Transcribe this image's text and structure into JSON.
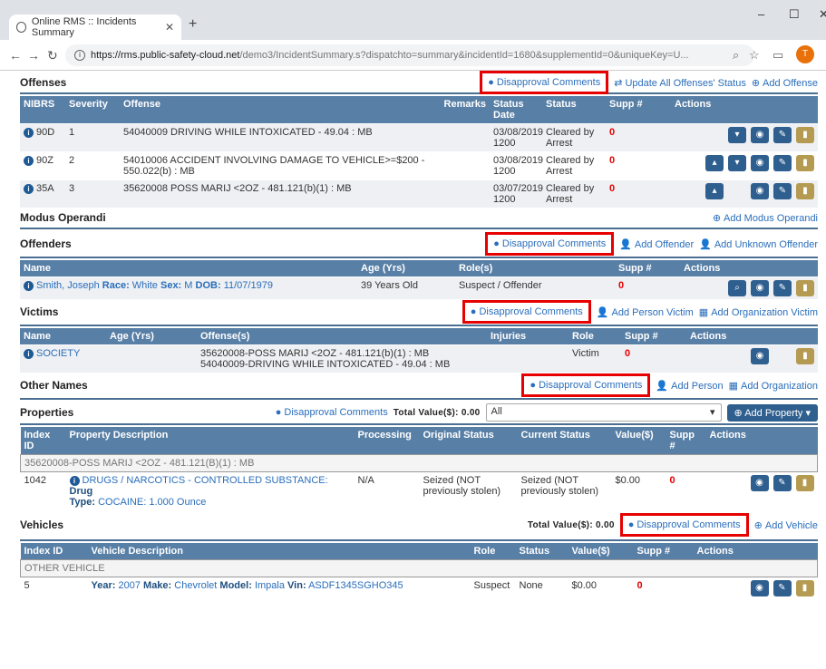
{
  "browser": {
    "tab_title": "Online RMS :: Incidents Summary",
    "url_host": "https://rms.public-safety-cloud.net",
    "url_path": "/demo3/IncidentSummary.s?dispatchto=summary&incidentId=1680&supplementId=0&uniqueKey=U...",
    "avatar_letter": "T"
  },
  "offenses": {
    "title": "Offenses",
    "actions": [
      "Disapproval Comments",
      "Update All Offenses' Status",
      "Add Offense"
    ],
    "headers": [
      "NIBRS",
      "Severity",
      "Offense",
      "Remarks",
      "Status Date",
      "Status",
      "Supp #",
      "Actions"
    ],
    "rows": [
      {
        "nibrs": "90D",
        "severity": "1",
        "offense": "54040009 DRIVING WHILE INTOXICATED - 49.04 : MB",
        "date": "03/08/2019 1200",
        "status": "Cleared by Arrest",
        "supp": "0"
      },
      {
        "nibrs": "90Z",
        "severity": "2",
        "offense": "54010006 ACCIDENT INVOLVING DAMAGE TO VEHICLE>=$200 - 550.022(b) : MB",
        "date": "03/08/2019 1200",
        "status": "Cleared by Arrest",
        "supp": "0"
      },
      {
        "nibrs": "35A",
        "severity": "3",
        "offense": "35620008 POSS MARIJ <2OZ - 481.121(b)(1) : MB",
        "date": "03/07/2019 1200",
        "status": "Cleared by Arrest",
        "supp": "0"
      }
    ]
  },
  "modus": {
    "title": "Modus Operandi",
    "action": "Add Modus Operandi"
  },
  "offenders": {
    "title": "Offenders",
    "actions": [
      "Disapproval Comments",
      "Add Offender",
      "Add Unknown Offender"
    ],
    "headers": [
      "Name",
      "Age (Yrs)",
      "Role(s)",
      "Supp #",
      "Actions"
    ],
    "row": {
      "name": "Smith, Joseph",
      "race_l": "Race:",
      "race": "White",
      "sex_l": "Sex:",
      "sex": "M",
      "dob_l": "DOB:",
      "dob": "11/07/1979",
      "age": "39 Years Old",
      "role": "Suspect / Offender",
      "supp": "0"
    }
  },
  "victims": {
    "title": "Victims",
    "actions": [
      "Disapproval Comments",
      "Add Person Victim",
      "Add Organization Victim"
    ],
    "headers": [
      "Name",
      "Age (Yrs)",
      "Offense(s)",
      "Injuries",
      "Role",
      "Supp #",
      "Actions"
    ],
    "row": {
      "name": "SOCIETY",
      "off1": "35620008-POSS MARIJ <2OZ - 481.121(b)(1) : MB",
      "off2": "54040009-DRIVING WHILE INTOXICATED - 49.04 : MB",
      "role": "Victim",
      "supp": "0"
    }
  },
  "other_names": {
    "title": "Other Names",
    "actions": [
      "Disapproval Comments",
      "Add Person",
      "Add Organization"
    ]
  },
  "properties": {
    "title": "Properties",
    "disapproval": "Disapproval Comments",
    "total_label": "Total Value($): 0.00",
    "filter": "All",
    "add_label": "Add Property",
    "headers": [
      "Index ID",
      "Property Description",
      "Processing",
      "Original Status",
      "Current Status",
      "Value($)",
      "Supp #",
      "Actions"
    ],
    "group": "35620008-POSS MARIJ <2OZ - 481.121(B)(1) : MB",
    "row": {
      "index": "1042",
      "desc1": "DRUGS / NARCOTICS - CONTROLLED SUBSTANCE:",
      "drug_l": "Drug",
      "desc2a": "Type:",
      "desc2b": "COCAINE: 1.000 Ounce",
      "processing": "N/A",
      "orig": "Seized (NOT previously stolen)",
      "curr": "Seized (NOT previously stolen)",
      "value": "$0.00",
      "supp": "0"
    }
  },
  "vehicles": {
    "title": "Vehicles",
    "total_label": "Total Value($): 0.00",
    "actions": [
      "Disapproval Comments",
      "Add Vehicle"
    ],
    "headers": [
      "Index ID",
      "Vehicle Description",
      "Role",
      "Status",
      "Value($)",
      "Supp #",
      "Actions"
    ],
    "group": "OTHER VEHICLE",
    "row": {
      "index": "5",
      "year_l": "Year:",
      "year": "2007",
      "make_l": "Make:",
      "make": "Chevrolet",
      "model_l": "Model:",
      "model": "Impala",
      "vin_l": "Vin:",
      "vin": "ASDF1345SGHO345",
      "role": "Suspect",
      "status": "None",
      "value": "$0.00",
      "supp": "0"
    }
  }
}
